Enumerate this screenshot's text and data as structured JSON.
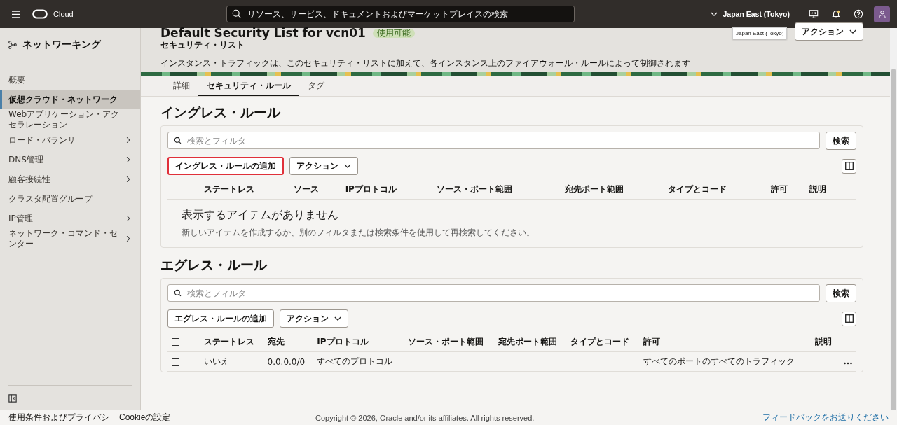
{
  "topbar": {
    "brand": "Cloud",
    "search_placeholder": "リソース、サービス、ドキュメントおよびマーケットプレイスの検索",
    "region": "Japan East (Tokyo)",
    "tooltip": "Japan East (Tokyo)"
  },
  "sidebar": {
    "title": "ネットワーキング",
    "items": [
      {
        "label": "概要",
        "selected": false,
        "expandable": false
      },
      {
        "label": "仮想クラウド・ネットワーク",
        "selected": true,
        "expandable": false
      },
      {
        "label": "Webアプリケーション・アクセラレーション",
        "selected": false,
        "expandable": false
      },
      {
        "label": "ロード・バランサ",
        "selected": false,
        "expandable": true
      },
      {
        "label": "DNS管理",
        "selected": false,
        "expandable": true
      },
      {
        "label": "顧客接続性",
        "selected": false,
        "expandable": true
      },
      {
        "label": "クラスタ配置グループ",
        "selected": false,
        "expandable": false
      },
      {
        "label": "IP管理",
        "selected": false,
        "expandable": true
      },
      {
        "label": "ネットワーク・コマンド・センター",
        "selected": false,
        "expandable": true
      }
    ]
  },
  "header": {
    "title": "Default Security List for vcn01",
    "badge": "使用可能",
    "subtitle": "セキュリティ・リスト",
    "description": "インスタンス・トラフィックは、このセキュリティ・リストに加えて、各インスタンス上のファイアウォール・ルールによって制御されます",
    "actions_button": "アクション"
  },
  "tabs": [
    {
      "label": "詳細",
      "selected": false
    },
    {
      "label": "セキュリティ・ルール",
      "selected": true
    },
    {
      "label": "タグ",
      "selected": false
    }
  ],
  "sections": [
    {
      "heading": "イングレス・ルール",
      "search_placeholder": "検索とフィルタ",
      "search_button": "検索",
      "add_button": "イングレス・ルールの追加",
      "add_highlighted": true,
      "actions_button": "アクション",
      "columns": [
        "ステートレス",
        "ソース",
        "IPプロトコル",
        "ソース・ポート範囲",
        "宛先ポート範囲",
        "タイプとコード",
        "許可",
        "説明"
      ],
      "empty_title": "表示するアイテムがありません",
      "empty_text": "新しいアイテムを作成するか、別のフィルタまたは検索条件を使用して再検索してください。"
    },
    {
      "heading": "エグレス・ルール",
      "search_placeholder": "検索とフィルタ",
      "search_button": "検索",
      "add_button": "エグレス・ルールの追加",
      "add_highlighted": false,
      "actions_button": "アクション",
      "select_all_checked": false,
      "columns": [
        "ステートレス",
        "宛先",
        "IPプロトコル",
        "ソース・ポート範囲",
        "宛先ポート範囲",
        "タイプとコード",
        "許可",
        "説明"
      ],
      "rows": [
        {
          "checked": false,
          "cells": [
            "いいえ",
            "0.0.0.0/0",
            "すべてのプロトコル",
            "",
            "",
            "",
            "すべてのポートのすべてのトラフィック",
            ""
          ]
        }
      ]
    }
  ],
  "footer": {
    "links": [
      "使用条件およびプライバシ",
      "Cookieの設定"
    ],
    "copyright": "Copyright © 2026, Oracle and/or its affiliates. All rights reserved.",
    "feedback": "フィードバックをお送りください"
  }
}
